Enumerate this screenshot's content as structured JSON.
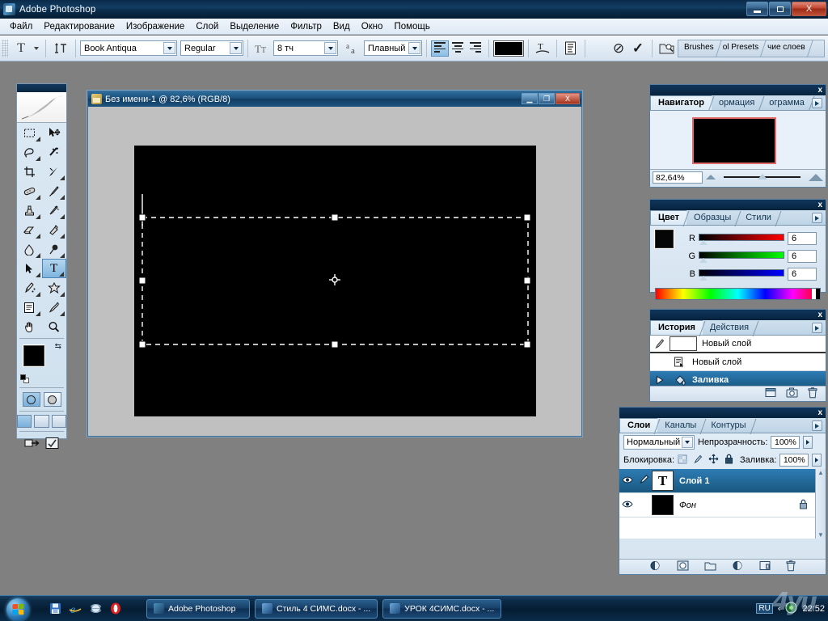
{
  "window": {
    "title": "Adobe Photoshop",
    "icon": "photoshop-icon",
    "minimize": "–",
    "restore": "❐",
    "close": "X"
  },
  "menubar": {
    "items": [
      {
        "label": "Файл"
      },
      {
        "label": "Редактирование"
      },
      {
        "label": "Изображение"
      },
      {
        "label": "Слой"
      },
      {
        "label": "Выделение"
      },
      {
        "label": "Фильтр"
      },
      {
        "label": "Вид"
      },
      {
        "label": "Окно"
      },
      {
        "label": "Помощь"
      }
    ]
  },
  "options_bar": {
    "tool_icon": "T",
    "orientation_icon": "text-orientation-icon",
    "font_family": "Book Antiqua",
    "font_style": "Regular",
    "font_size": "8 тч",
    "antialias_label": "aa",
    "antialias": "Плавный",
    "align_left": "align-left-icon",
    "align_center": "align-center-icon",
    "align_right": "align-right-icon",
    "text_color": "#000000",
    "warp_icon": "warp-text-icon",
    "palettes_icon": "toggle-palettes-icon",
    "cancel_icon": "⊘",
    "commit_icon": "✓",
    "bridge_icon": "file-browser-icon",
    "palette_well": [
      {
        "label": "Brushes"
      },
      {
        "label": "ol Presets"
      },
      {
        "label": "чие слоев"
      }
    ]
  },
  "toolbox": {
    "logo": "feather-logo",
    "tools": [
      {
        "name": "marquee-tool",
        "glyph": "▯",
        "selected": false,
        "has_flyout": true
      },
      {
        "name": "move-tool",
        "glyph": "✥",
        "selected": false,
        "has_flyout": false
      },
      {
        "name": "lasso-tool",
        "glyph": "⌁",
        "selected": false,
        "has_flyout": true
      },
      {
        "name": "magic-wand-tool",
        "glyph": "✦",
        "selected": false,
        "has_flyout": false
      },
      {
        "name": "crop-tool",
        "glyph": "⌗",
        "selected": false,
        "has_flyout": false
      },
      {
        "name": "slice-tool",
        "glyph": "✂",
        "selected": false,
        "has_flyout": true
      },
      {
        "name": "healing-brush-tool",
        "glyph": "◍",
        "selected": false,
        "has_flyout": true
      },
      {
        "name": "brush-tool",
        "glyph": "✎",
        "selected": false,
        "has_flyout": true
      },
      {
        "name": "clone-stamp-tool",
        "glyph": "⎙",
        "selected": false,
        "has_flyout": true
      },
      {
        "name": "history-brush-tool",
        "glyph": "✐",
        "selected": false,
        "has_flyout": true
      },
      {
        "name": "eraser-tool",
        "glyph": "◰",
        "selected": false,
        "has_flyout": true
      },
      {
        "name": "gradient-tool",
        "glyph": "◧",
        "selected": false,
        "has_flyout": true
      },
      {
        "name": "blur-tool",
        "glyph": "💧",
        "selected": false,
        "has_flyout": true
      },
      {
        "name": "dodge-tool",
        "glyph": "●",
        "selected": false,
        "has_flyout": true
      },
      {
        "name": "path-selection-tool",
        "glyph": "➤",
        "selected": false,
        "has_flyout": true
      },
      {
        "name": "type-tool",
        "glyph": "T",
        "selected": true,
        "has_flyout": true
      },
      {
        "name": "pen-tool",
        "glyph": "✒",
        "selected": false,
        "has_flyout": true
      },
      {
        "name": "custom-shape-tool",
        "glyph": "✿",
        "selected": false,
        "has_flyout": true
      },
      {
        "name": "notes-tool",
        "glyph": "▤",
        "selected": false,
        "has_flyout": true
      },
      {
        "name": "eyedropper-tool",
        "glyph": "⚲",
        "selected": false,
        "has_flyout": true
      },
      {
        "name": "hand-tool",
        "glyph": "✋",
        "selected": false,
        "has_flyout": false
      },
      {
        "name": "zoom-tool",
        "glyph": "🔍",
        "selected": false,
        "has_flyout": false
      }
    ],
    "foreground_color": "#000000",
    "background_color": "#ffffff",
    "swap_icon": "swap-colors-icon",
    "default_colors_icon": "default-colors-icon",
    "standard_mask_icon": "standard-mode-icon",
    "quick_mask_icon": "quick-mask-mode-icon",
    "screen_mode_icons": [
      "standard-screen-icon",
      "fullscreen-menubar-icon",
      "fullscreen-icon"
    ],
    "imageready_icon": "edit-in-imageready-icon",
    "jump_icon": "jump-to-icon"
  },
  "document": {
    "title": "Без имени-1 @ 82,6% (RGB/8)",
    "icon": "document-icon",
    "minimize": "–",
    "restore": "❐",
    "close": "X",
    "canvas_color": "#000000",
    "text_box": {
      "state": "active-text-bounding-box",
      "handles": 8,
      "reference_point": "center"
    }
  },
  "navigator": {
    "close": "x",
    "tabs": [
      {
        "label": "Навигатор",
        "active": true
      },
      {
        "label": "ормация",
        "active": false
      },
      {
        "label": "ограмма",
        "active": false
      }
    ],
    "menu_icon": "panel-menu-icon",
    "zoom_value": "82,64%",
    "zoom_out_icon": "zoom-out-icon",
    "zoom_in_icon": "zoom-in-icon"
  },
  "color_panel": {
    "close": "x",
    "tabs": [
      {
        "label": "Цвет",
        "active": true
      },
      {
        "label": "Образцы",
        "active": false
      },
      {
        "label": "Стили",
        "active": false
      }
    ],
    "menu_icon": "panel-menu-icon",
    "channels": [
      {
        "label": "R",
        "value": "6"
      },
      {
        "label": "G",
        "value": "6"
      },
      {
        "label": "B",
        "value": "6"
      }
    ],
    "foreground": "#060606",
    "background": "#ffffff"
  },
  "history_panel": {
    "close": "x",
    "tabs": [
      {
        "label": "История",
        "active": true
      },
      {
        "label": "Действия",
        "active": false
      }
    ],
    "menu_icon": "panel-menu-icon",
    "snapshot": {
      "label": "Новый слой",
      "icon": "snapshot-icon"
    },
    "states": [
      {
        "label": "Новый слой",
        "icon": "new-layer-state-icon",
        "selected": false
      },
      {
        "label": "Заливка",
        "icon": "fill-state-icon",
        "selected": true
      }
    ],
    "footer_icons": [
      "new-document-from-state-icon",
      "new-snapshot-icon",
      "delete-state-icon"
    ]
  },
  "layers_panel": {
    "close": "x",
    "tabs": [
      {
        "label": "Слои",
        "active": true
      },
      {
        "label": "Каналы",
        "active": false
      },
      {
        "label": "Контуры",
        "active": false
      }
    ],
    "menu_icon": "panel-menu-icon",
    "blend_mode": "Нормальный",
    "opacity_label": "Непрозрачность:",
    "opacity_value": "100%",
    "lock_label": "Блокировка:",
    "lock_icons": [
      "lock-transparency-icon",
      "lock-image-icon",
      "lock-position-icon",
      "lock-all-icon"
    ],
    "fill_label": "Заливка:",
    "fill_value": "100%",
    "layers": [
      {
        "name": "Слой 1",
        "type": "text",
        "thumb_glyph": "T",
        "visible": true,
        "selected": true,
        "locked": false,
        "linked": true
      },
      {
        "name": "Фон",
        "type": "background",
        "thumb_color": "#000000",
        "visible": true,
        "selected": false,
        "locked": true,
        "linked": false
      }
    ],
    "footer_icons": [
      "layer-style-icon",
      "layer-mask-icon",
      "new-group-icon",
      "adjustment-layer-icon",
      "new-layer-icon",
      "delete-layer-icon"
    ]
  },
  "taskbar": {
    "start_label": "start-orb",
    "quick_launch": [
      {
        "name": "save-icon",
        "glyph": "▤",
        "color": "#2a6fc0"
      },
      {
        "name": "internet-explorer-icon",
        "glyph": "e",
        "color": "#2a8fd8"
      },
      {
        "name": "globe-icon",
        "glyph": "◉",
        "color": "#d8e8f0"
      },
      {
        "name": "opera-icon",
        "glyph": "O",
        "color": "#e02020"
      }
    ],
    "tasks": [
      {
        "label": "Adobe Photoshop",
        "icon_color": "#4a8fc0",
        "active": true
      },
      {
        "label": "Стиль 4 СИМС.docx - ...",
        "icon_color": "#2a6fc0",
        "active": false
      },
      {
        "label": "УРОК 4СИМС.docx - ...",
        "icon_color": "#2a6fc0",
        "active": false
      }
    ],
    "tray": {
      "language": "RU",
      "clock": "22:52",
      "overflow_icon": "‹"
    },
    "watermark": "4yu"
  }
}
